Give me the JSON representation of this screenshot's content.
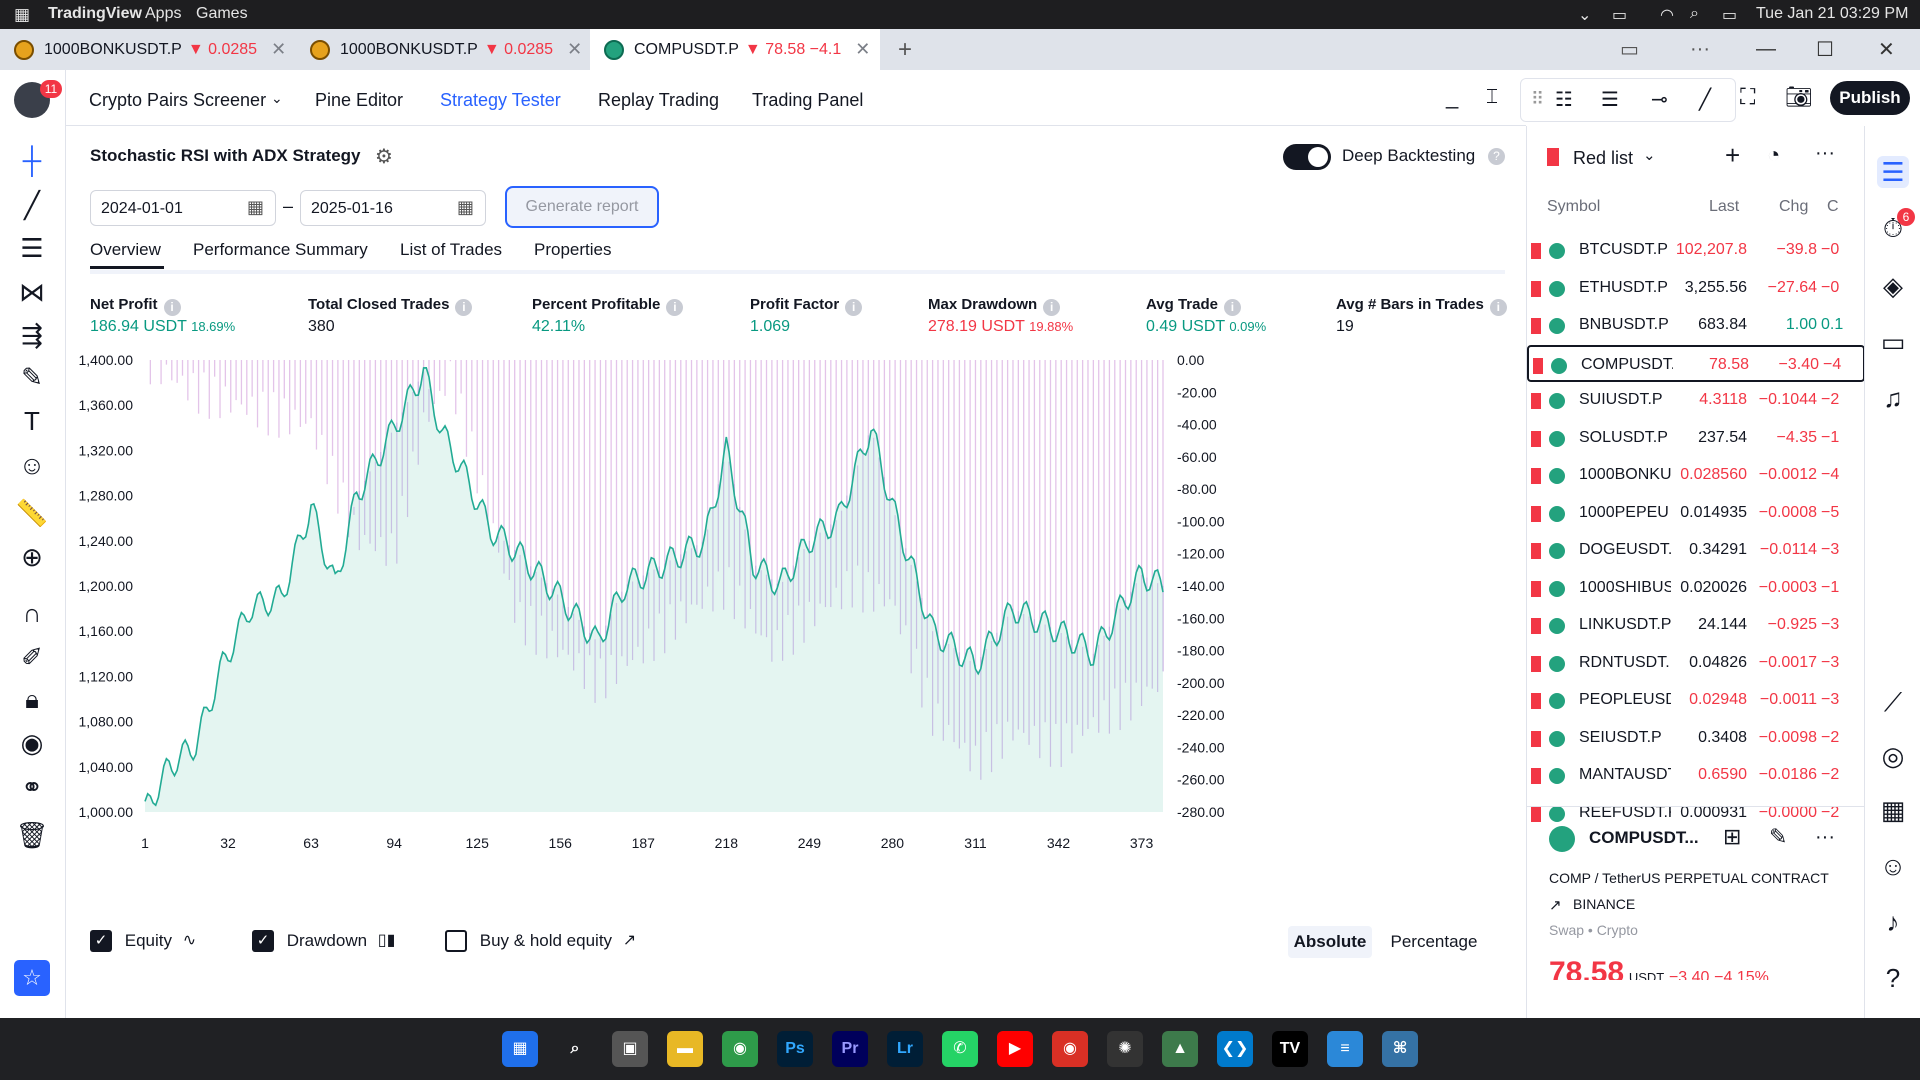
{
  "os": {
    "app_name": "TradingView",
    "menu": [
      "Apps",
      "Games"
    ],
    "datetime": "Tue Jan 21  03:29 PM"
  },
  "tabs": [
    {
      "label": "1000BONKUSDT.P",
      "change": "▼ 0.0285"
    },
    {
      "label": "1000BONKUSDT.P",
      "change": "▼ 0.0285"
    },
    {
      "label": "COMPUSDT.P",
      "change": "▼ 78.58 −4.1"
    }
  ],
  "header": {
    "badge": "11",
    "menu": [
      "Crypto Pairs Screener",
      "Pine Editor",
      "Strategy Tester",
      "Replay Trading",
      "Trading Panel"
    ],
    "publish": "Publish"
  },
  "strategy": {
    "name": "Stochastic RSI with ADX Strategy",
    "deep_label": "Deep Backtesting",
    "date_from": "2024-01-01",
    "date_to": "2025-01-16",
    "generate": "Generate report",
    "tabs": [
      "Overview",
      "Performance Summary",
      "List of Trades",
      "Properties"
    ],
    "metrics": [
      {
        "label": "Net Profit",
        "value": "186.94 USDT",
        "pct": "18.69%",
        "color": "#089981"
      },
      {
        "label": "Total Closed Trades",
        "value": "380",
        "pct": "",
        "color": "#131722"
      },
      {
        "label": "Percent Profitable",
        "value": "42.11%",
        "pct": "",
        "color": "#089981"
      },
      {
        "label": "Profit Factor",
        "value": "1.069",
        "pct": "",
        "color": "#089981"
      },
      {
        "label": "Max Drawdown",
        "value": "278.19 USDT",
        "pct": "19.88%",
        "color": "#f23645"
      },
      {
        "label": "Avg Trade",
        "value": "0.49 USDT",
        "pct": "0.09%",
        "color": "#089981"
      },
      {
        "label": "Avg # Bars in Trades",
        "value": "19",
        "pct": "",
        "color": "#131722"
      }
    ],
    "legend": {
      "equity": "Equity",
      "drawdown": "Drawdown",
      "buyhold": "Buy & hold equity",
      "absolute": "Absolute",
      "percentage": "Percentage"
    }
  },
  "chart_data": {
    "type": "line",
    "x_ticks": [
      "1",
      "32",
      "63",
      "94",
      "125",
      "156",
      "187",
      "218",
      "249",
      "280",
      "311",
      "342",
      "373"
    ],
    "y_left_ticks": [
      "1,400.00",
      "1,360.00",
      "1,320.00",
      "1,280.00",
      "1,240.00",
      "1,200.00",
      "1,160.00",
      "1,120.00",
      "1,080.00",
      "1,040.00",
      "1,000.00"
    ],
    "y_right_ticks": [
      "0.00",
      "-20.00",
      "-40.00",
      "-60.00",
      "-80.00",
      "-100.00",
      "-120.00",
      "-140.00",
      "-160.00",
      "-180.00",
      "-200.00",
      "-220.00",
      "-240.00",
      "-260.00",
      "-280.00"
    ],
    "ylim_equity": [
      1000,
      1400
    ],
    "ylim_drawdown": [
      -280,
      0
    ],
    "series": [
      {
        "name": "Equity",
        "color": "#22ab94",
        "x": [
          1,
          10,
          20,
          30,
          40,
          52,
          63,
          72,
          80,
          94,
          105,
          112,
          120,
          130,
          140,
          156,
          170,
          180,
          195,
          210,
          218,
          228,
          238,
          249,
          260,
          272,
          280,
          295,
          311,
          325,
          342,
          355,
          365,
          373,
          381
        ],
        "values": [
          1000,
          1040,
          1060,
          1130,
          1180,
          1190,
          1270,
          1200,
          1280,
          1340,
          1390,
          1335,
          1300,
          1250,
          1230,
          1190,
          1150,
          1200,
          1220,
          1240,
          1320,
          1220,
          1200,
          1240,
          1260,
          1340,
          1270,
          1160,
          1130,
          1180,
          1160,
          1140,
          1180,
          1210,
          1200
        ]
      },
      {
        "name": "Drawdown",
        "color": "#b39ddb",
        "x": [
          1,
          20,
          40,
          63,
          80,
          94,
          105,
          115,
          125,
          140,
          156,
          170,
          187,
          200,
          218,
          235,
          249,
          265,
          280,
          295,
          311,
          325,
          342,
          360,
          381
        ],
        "values": [
          0,
          -20,
          -30,
          -40,
          -110,
          -120,
          -40,
          -10,
          -70,
          -160,
          -180,
          -200,
          -180,
          -160,
          -140,
          -180,
          -160,
          -140,
          -150,
          -220,
          -250,
          -230,
          -240,
          -220,
          -200
        ]
      }
    ]
  },
  "watchlist": {
    "title": "Red list",
    "cols": [
      "Symbol",
      "Last",
      "Chg",
      "C"
    ],
    "rows": [
      {
        "symbol": "BTCUSDT.P",
        "last": "102,207.8",
        "chg": "−39.8",
        "chp": "−0",
        "lc": "#f23645",
        "cc": "#f23645"
      },
      {
        "symbol": "ETHUSDT.P",
        "last": "3,255.56",
        "chg": "−27.64",
        "chp": "−0",
        "lc": "#131722",
        "cc": "#f23645"
      },
      {
        "symbol": "BNBUSDT.P",
        "last": "683.84",
        "chg": "1.00",
        "chp": "0.1",
        "lc": "#131722",
        "cc": "#089981"
      },
      {
        "symbol": "COMPUSDT.",
        "last": "78.58",
        "chg": "−3.40",
        "chp": "−4",
        "lc": "#f23645",
        "cc": "#f23645"
      },
      {
        "symbol": "SUIUSDT.P",
        "last": "4.3118",
        "chg": "−0.1044",
        "chp": "−2",
        "lc": "#f23645",
        "cc": "#f23645"
      },
      {
        "symbol": "SOLUSDT.P",
        "last": "237.54",
        "chg": "−4.35",
        "chp": "−1",
        "lc": "#131722",
        "cc": "#f23645"
      },
      {
        "symbol": "1000BONKU",
        "last": "0.028560",
        "chg": "−0.0012",
        "chp": "−4",
        "lc": "#f23645",
        "cc": "#f23645"
      },
      {
        "symbol": "1000PEPEU",
        "last": "0.014935",
        "chg": "−0.0008",
        "chp": "−5",
        "lc": "#131722",
        "cc": "#f23645"
      },
      {
        "symbol": "DOGEUSDT.",
        "last": "0.34291",
        "chg": "−0.0114",
        "chp": "−3",
        "lc": "#131722",
        "cc": "#f23645"
      },
      {
        "symbol": "1000SHIBUS",
        "last": "0.020026",
        "chg": "−0.0003",
        "chp": "−1",
        "lc": "#131722",
        "cc": "#f23645"
      },
      {
        "symbol": "LINKUSDT.P",
        "last": "24.144",
        "chg": "−0.925",
        "chp": "−3",
        "lc": "#131722",
        "cc": "#f23645"
      },
      {
        "symbol": "RDNTUSDT.",
        "last": "0.04826",
        "chg": "−0.0017",
        "chp": "−3",
        "lc": "#131722",
        "cc": "#f23645"
      },
      {
        "symbol": "PEOPLEUSD",
        "last": "0.02948",
        "chg": "−0.0011",
        "chp": "−3",
        "lc": "#f23645",
        "cc": "#f23645"
      },
      {
        "symbol": "SEIUSDT.P",
        "last": "0.3408",
        "chg": "−0.0098",
        "chp": "−2",
        "lc": "#131722",
        "cc": "#f23645"
      },
      {
        "symbol": "MANTAUSDT",
        "last": "0.6590",
        "chg": "−0.0186",
        "chp": "−2",
        "lc": "#f23645",
        "cc": "#f23645"
      },
      {
        "symbol": "REEFUSDT.P",
        "last": "0.000931",
        "chg": "−0.0000",
        "chp": "−2",
        "lc": "#131722",
        "cc": "#f23645"
      }
    ]
  },
  "details": {
    "symbol": "COMPUSDT...",
    "desc": "COMP / TetherUS PERPETUAL CONTRACT",
    "exchange": "BINANCE",
    "type": "Swap • Crypto",
    "price": "78.58",
    "currency": "USDT",
    "chg": "−3.40",
    "chp": "−4.15%"
  },
  "alerts_badge": "6"
}
